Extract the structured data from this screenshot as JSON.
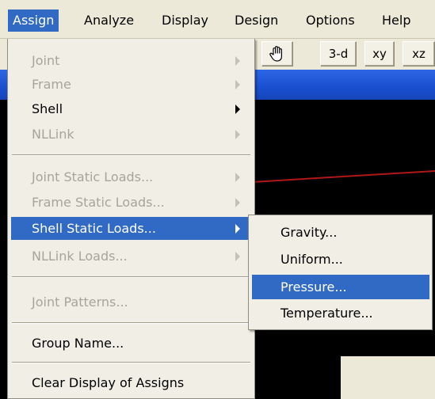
{
  "menubar": {
    "items": [
      {
        "label": "Assign",
        "active": true
      },
      {
        "label": "Analyze"
      },
      {
        "label": "Display"
      },
      {
        "label": "Design"
      },
      {
        "label": "Options"
      },
      {
        "label": "Help"
      }
    ]
  },
  "toolbar": {
    "pan_icon": "hand-icon",
    "buttons": [
      "3-d",
      "xy",
      "xz"
    ]
  },
  "assign_menu": {
    "items": [
      {
        "label": "Joint",
        "enabled": false,
        "submenu": true
      },
      {
        "label": "Frame",
        "enabled": false,
        "submenu": true
      },
      {
        "label": "Shell",
        "enabled": true,
        "submenu": true
      },
      {
        "label": "NLLink",
        "enabled": false,
        "submenu": true
      },
      {
        "label": "Joint Static Loads...",
        "enabled": false,
        "submenu": true
      },
      {
        "label": "Frame Static Loads...",
        "enabled": false,
        "submenu": true
      },
      {
        "label": "Shell Static Loads...",
        "enabled": true,
        "submenu": true,
        "highlighted": true
      },
      {
        "label": "NLLink Loads...",
        "enabled": false,
        "submenu": true
      },
      {
        "label": "Joint Patterns...",
        "enabled": false
      },
      {
        "label": "Group Name...",
        "enabled": true
      },
      {
        "label": "Clear Display of Assigns",
        "enabled": true
      }
    ]
  },
  "shell_static_loads_submenu": {
    "items": [
      {
        "label": "Gravity..."
      },
      {
        "label": "Uniform..."
      },
      {
        "label": "Pressure...",
        "highlighted": true
      },
      {
        "label": "Temperature..."
      }
    ]
  },
  "colors": {
    "highlight": "#316ac5",
    "menu_bg": "#f1efe5",
    "disabled_text": "#a7a59a",
    "canvas": "#000000",
    "title_bar": "#1a4fcf",
    "model_line": "#b01818"
  }
}
